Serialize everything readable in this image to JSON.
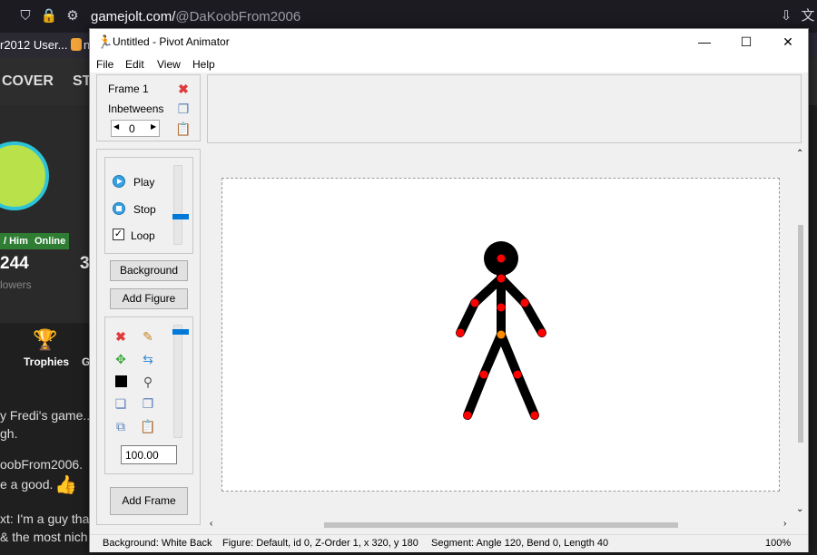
{
  "browser": {
    "url_host": "gamejolt.com/",
    "url_path": "@DaKoobFrom2006",
    "bookmark_1": "r2012 User...",
    "bookmark_2": "n"
  },
  "site": {
    "nav_1": "COVER",
    "nav_2": "ST",
    "badge_pronoun": "/ Him",
    "badge_status": "Online",
    "followers_count": "244",
    "followers_label": "lowers",
    "other_count": "3",
    "trophies_label": "Trophies",
    "other_tab": "G",
    "post_1": "y Fredi's game...",
    "post_1b": "gh.",
    "post_2": "oobFrom2006.",
    "post_2b": "e a good.",
    "post_3": "xt: I'm a guy tha",
    "post_3b": "& the most nich"
  },
  "window": {
    "title": "Untitled - Pivot Animator",
    "minimize": "—",
    "maximize": "☐",
    "close": "✕"
  },
  "menu": {
    "file": "File",
    "edit": "Edit",
    "view": "View",
    "help": "Help"
  },
  "frame_panel": {
    "frame_label": "Frame 1",
    "inbetweens_label": "Inbetweens",
    "inbetweens_value": "0"
  },
  "playback": {
    "play": "Play",
    "stop": "Stop",
    "loop": "Loop",
    "loop_checked": true,
    "speed_level": 0.5
  },
  "buttons": {
    "background": "Background",
    "add_figure": "Add Figure",
    "add_frame": "Add Frame"
  },
  "figure_tools": {
    "scale_value": "100.00",
    "scale_level": 0.0
  },
  "status": {
    "background": "Background: White Back",
    "figure": "Figure: Default,  id 0,  Z-Order 1,  x 320, y 180",
    "segment": "Segment: Angle 120,  Bend 0,  Length 40",
    "zoom": "100%"
  },
  "colors": {
    "joint": "#ff0000",
    "origin_joint": "#ff8c00",
    "figure": "#000000",
    "accent": "#0078d7"
  }
}
